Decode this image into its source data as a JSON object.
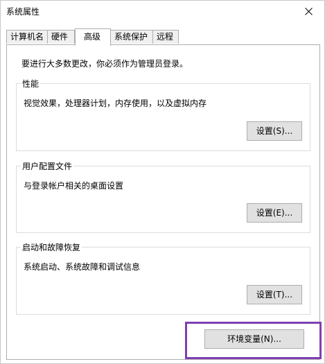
{
  "window": {
    "title": "系统属性"
  },
  "tabs": [
    {
      "label": "计算机名"
    },
    {
      "label": "硬件"
    },
    {
      "label": "高级"
    },
    {
      "label": "系统保护"
    },
    {
      "label": "远程"
    }
  ],
  "active_tab": "高级",
  "notice": "要进行大多数更改，你必须作为管理员登录。",
  "groups": {
    "performance": {
      "label": "性能",
      "description": "视觉效果，处理器计划，内存使用，以及虚拟内存",
      "button": "设置(S)..."
    },
    "user_profiles": {
      "label": "用户配置文件",
      "description": "与登录帐户相关的桌面设置",
      "button": "设置(E)..."
    },
    "startup_recovery": {
      "label": "启动和故障恢复",
      "description": "系统启动、系统故障和调试信息",
      "button": "设置(T)..."
    }
  },
  "env_button": "环境变量(N)...",
  "colors": {
    "highlight": "#7e3fb2",
    "button_bg": "#e1e1e1",
    "border": "#adadad"
  },
  "icons": {
    "close": "close-icon"
  }
}
